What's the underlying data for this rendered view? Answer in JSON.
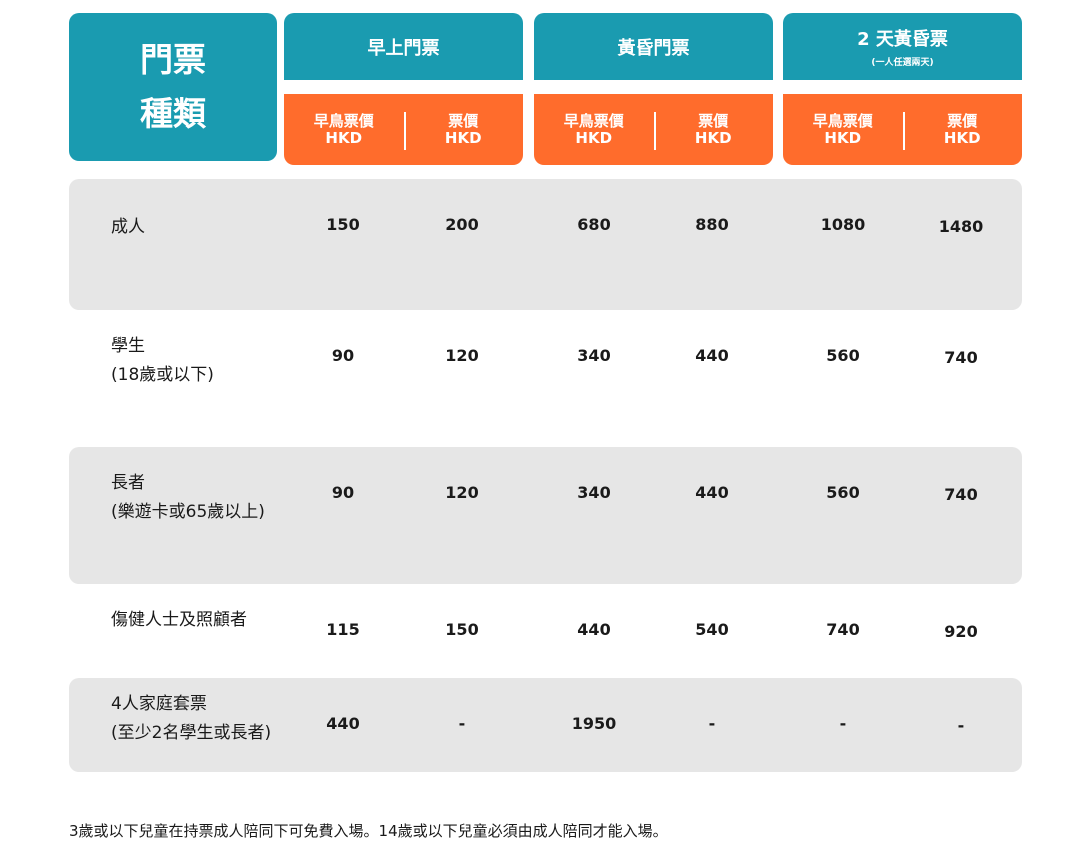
{
  "header": {
    "corner_line1": "門票",
    "corner_line2": "種類",
    "groups": [
      {
        "title": "早上門票",
        "sub": "",
        "early_label": "早鳥票價",
        "regular_label": "票價",
        "currency": "HKD"
      },
      {
        "title": "黃昏門票",
        "sub": "",
        "early_label": "早鳥票價",
        "regular_label": "票價",
        "currency": "HKD"
      },
      {
        "title": "2 天黃昏票",
        "sub": "(一人任選兩天)",
        "early_label": "早鳥票價",
        "regular_label": "票價",
        "currency": "HKD"
      }
    ]
  },
  "rows": [
    {
      "label1": "成人",
      "label2": "",
      "values": [
        "150",
        "200",
        "680",
        "880",
        "1080",
        "1480"
      ]
    },
    {
      "label1": "學生",
      "label2": "(18歲或以下)",
      "values": [
        "90",
        "120",
        "340",
        "440",
        "560",
        "740"
      ]
    },
    {
      "label1": "長者",
      "label2": "(樂遊卡或65歲以上)",
      "values": [
        "90",
        "120",
        "340",
        "440",
        "560",
        "740"
      ]
    },
    {
      "label1": "傷健人士及照顧者",
      "label2": "",
      "values": [
        "115",
        "150",
        "440",
        "540",
        "740",
        "920"
      ]
    },
    {
      "label1": "4人家庭套票",
      "label2": "(至少2名學生或長者)",
      "values": [
        "440",
        "-",
        "1950",
        "-",
        "-",
        "-"
      ]
    }
  ],
  "footnote": "3歲或以下兒童在持票成人陪同下可免費入場。14歲或以下兒童必須由成人陪同才能入場。",
  "colors": {
    "teal": "#1a9bb0",
    "orange": "#ff6c2c",
    "row_shade": "#e6e6e6"
  }
}
